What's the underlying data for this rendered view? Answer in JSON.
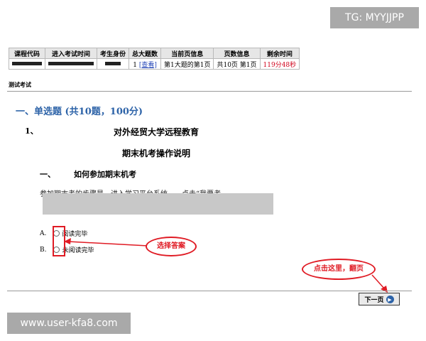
{
  "watermarks": {
    "top": "TG: MYYJJPP",
    "bottom": "www.user-kfa8.com"
  },
  "info_table": {
    "headers": [
      "课程代码",
      "进入考试时间",
      "考生身份",
      "总大题数",
      "当前页信息",
      "页数信息",
      "剩余时间"
    ],
    "total_questions": "1",
    "view_link": "[查看]",
    "current_page": "第1大题的第1页",
    "page_count": "共10页 第1页",
    "remaining_time": "119分48秒"
  },
  "exam_title": "测试考试",
  "section_title": "一、单选题 (共10题，100分)",
  "question": {
    "number": "1、",
    "title1": "对外经贸大学远程教育",
    "title2": "期末机考操作说明",
    "sub_number": "一、",
    "sub_title": "如何参加期末机考",
    "paragraph": "参加期末考的步骤是，进入学习平台系统——点击“我要考"
  },
  "options": [
    {
      "letter": "A.",
      "label": "阅读完毕"
    },
    {
      "letter": "B.",
      "label": "未阅读完毕"
    }
  ],
  "annotations": {
    "select_answer": "选择答案",
    "next_page_hint": "点击这里，翻页"
  },
  "next_button": {
    "label": "下一页"
  },
  "colors": {
    "section_blue": "#2d63a8",
    "annotation_red": "#e01b24",
    "link_blue": "#2647b8"
  }
}
